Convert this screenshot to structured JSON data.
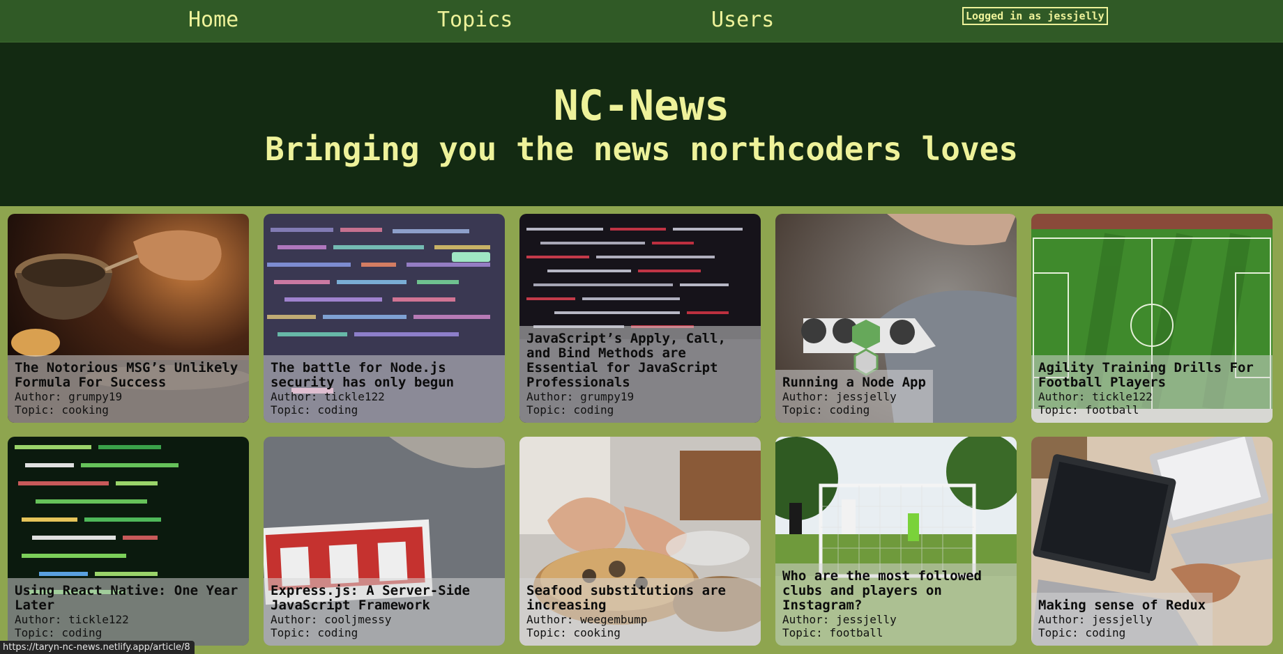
{
  "nav": {
    "home": "Home",
    "topics": "Topics",
    "users": "Users",
    "login_status": "Logged in as jessjelly"
  },
  "hero": {
    "title": "NC-News",
    "subtitle": "Bringing you the news northcoders loves"
  },
  "articles": [
    {
      "title": "The Notorious MSG’s Unlikely Formula For Success",
      "author": "Author: grumpy19",
      "topic": "Topic: cooking",
      "image": "cooking-pan-photo"
    },
    {
      "title": "The battle for Node.js security has only begun",
      "author": "Author: tickle122",
      "topic": "Topic: coding",
      "image": "colorful-code-screen-photo"
    },
    {
      "title": "JavaScript’s Apply, Call, and Bind Methods are Essential for JavaScript Professionals",
      "author": "Author: grumpy19",
      "topic": "Topic: coding",
      "image": "red-code-screen-photo"
    },
    {
      "title": "Running a Node App",
      "author": "Author: jessjelly",
      "topic": "Topic: coding",
      "image": "node-js-sticker-photo"
    },
    {
      "title": "Agility Training Drills For Football Players",
      "author": "Author: tickle122",
      "topic": "Topic: football",
      "image": "football-pitch-aerial-photo"
    },
    {
      "title": "Using React Native: One Year Later",
      "author": "Author: tickle122",
      "topic": "Topic: coding",
      "image": "green-code-screen-photo"
    },
    {
      "title": "Express.js: A Server-Side JavaScript Framework",
      "author": "Author: cooljmessy",
      "topic": "Topic: coding",
      "image": "npm-sticker-photo"
    },
    {
      "title": "Seafood substitutions are increasing",
      "author": "Author: weegembump",
      "topic": "Topic: cooking",
      "image": "chef-plating-photo"
    },
    {
      "title": "Who are the most followed clubs and players on Instagram?",
      "author": "Author: jessjelly",
      "topic": "Topic: football",
      "image": "womens-football-match-photo"
    },
    {
      "title": "Making sense of Redux",
      "author": "Author: jessjelly",
      "topic": "Topic: coding",
      "image": "laptops-desk-photo"
    }
  ],
  "status_bar": {
    "url": "https://taryn-nc-news.netlify.app/article/8"
  }
}
